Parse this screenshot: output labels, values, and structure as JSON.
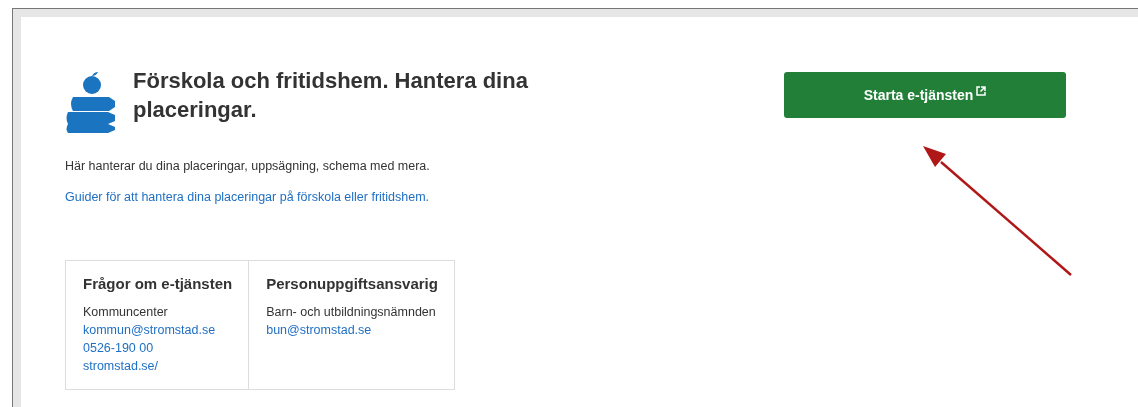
{
  "title": "Förskola och fritidshem. Hantera dina placeringar.",
  "start_button": {
    "label": "Starta e-tjänsten",
    "external": true
  },
  "description": "Här hanterar du dina placeringar, uppsägning, schema med mera.",
  "guide_link": "Guider för att hantera dina placeringar på förskola eller fritidshem.",
  "contact_table": [
    {
      "heading": "Frågor om e-tjänsten",
      "lines": [
        {
          "kind": "text",
          "text": "Kommuncenter"
        },
        {
          "kind": "link",
          "text": "kommun@stromstad.se"
        },
        {
          "kind": "link",
          "text": "0526-190 00"
        },
        {
          "kind": "link",
          "text": "stromstad.se/"
        }
      ]
    },
    {
      "heading": "Personuppgiftsansvarig",
      "lines": [
        {
          "kind": "text",
          "text": "Barn- och utbildningsnämnden"
        },
        {
          "kind": "link",
          "text": "bun@stromstad.se"
        }
      ]
    }
  ],
  "annotation_arrow": true
}
